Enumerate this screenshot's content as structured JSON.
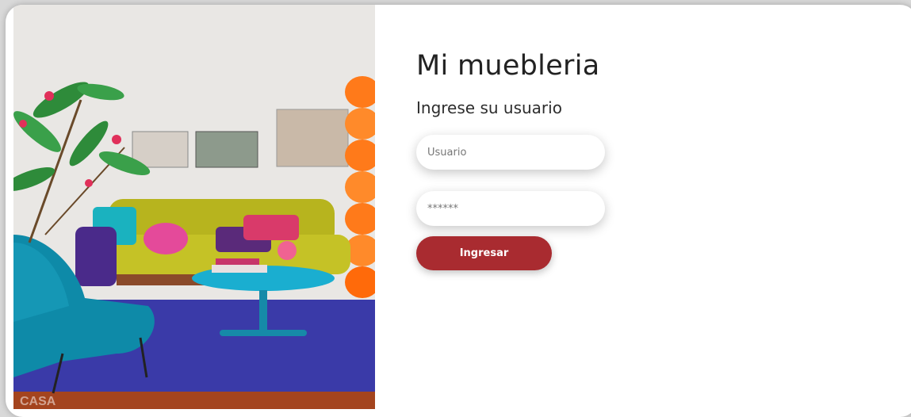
{
  "app": {
    "title": "Mi muebleria",
    "subtitle": "Ingrese su usuario"
  },
  "form": {
    "username_placeholder": "Usuario",
    "password_placeholder": "******",
    "submit_label": "Ingresar"
  },
  "image": {
    "watermark": "CASA"
  },
  "colors": {
    "accent": "#a92b30",
    "background": "#ffffff"
  }
}
